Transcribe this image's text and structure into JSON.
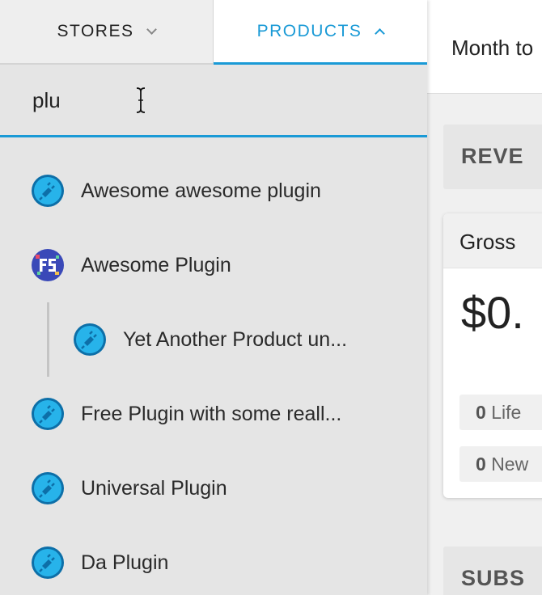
{
  "tabs": {
    "stores_label": "STORES",
    "products_label": "PRODUCTS"
  },
  "search": {
    "value": "plu"
  },
  "products": [
    {
      "label": "Awesome awesome plugin",
      "icon": "plug-icon",
      "indent": 0
    },
    {
      "label": "Awesome Plugin",
      "icon": "freemius-logo-icon",
      "indent": 0
    },
    {
      "label": "Yet Another Product un...",
      "icon": "plug-icon",
      "indent": 1
    },
    {
      "label": "Free Plugin with some reall...",
      "icon": "plug-icon",
      "indent": 0
    },
    {
      "label": "Universal Plugin",
      "icon": "plug-icon",
      "indent": 0
    },
    {
      "label": "Da Plugin",
      "icon": "plug-icon",
      "indent": 0
    }
  ],
  "dashboard": {
    "period_label": "Month to",
    "revenue_title": "REVE",
    "gross_title": "Gross",
    "amount": "$0.",
    "stat_lifetime_count": "0",
    "stat_lifetime_label": "Life",
    "stat_new_count": "0",
    "stat_new_label": "New",
    "subs_title": "SUBS"
  },
  "colors": {
    "accent": "#1a9ad6",
    "panel_bg": "#e5e5e5",
    "plug_icon_bg": "#1aa6e0"
  }
}
